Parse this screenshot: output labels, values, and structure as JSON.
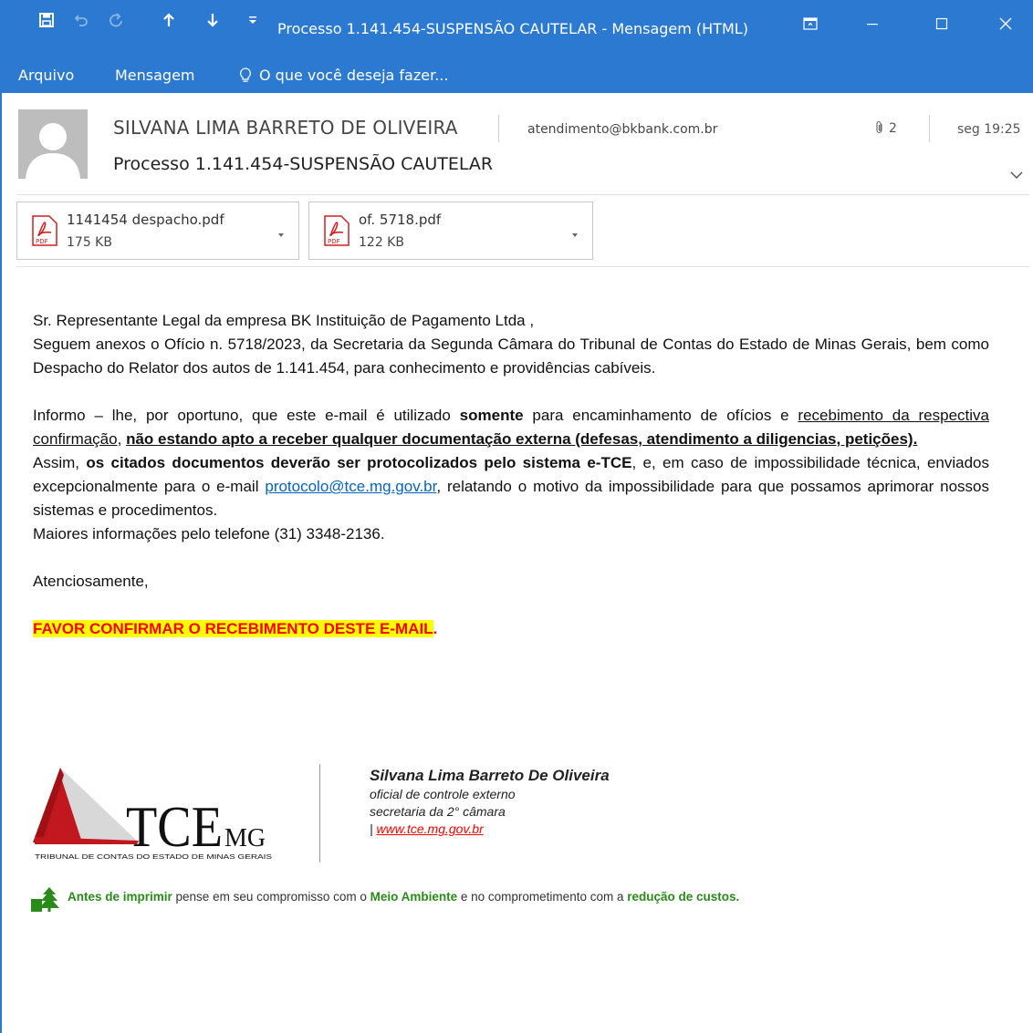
{
  "window": {
    "title": "Processo 1.141.454-SUSPENSÃO CAUTELAR - Mensagem (HTML)",
    "brand_color": "#2b79d0"
  },
  "ribbon": {
    "tabs": [
      "Arquivo",
      "Mensagem"
    ],
    "tell_me": "O que você deseja fazer..."
  },
  "message": {
    "sender": "SILVANA LIMA BARRETO DE OLIVEIRA",
    "recipient": "atendimento@bkbank.com.br",
    "attachment_count": "2",
    "date": "seg 19:25",
    "subject": "Processo 1.141.454-SUSPENSÃO CAUTELAR"
  },
  "attachments": [
    {
      "name": "1141454 despacho.pdf",
      "size": "175 KB",
      "icon": "pdf-icon"
    },
    {
      "name": "of. 5718.pdf",
      "size": "122 KB",
      "icon": "pdf-icon"
    }
  ],
  "body": {
    "greeting": "Sr. Representante Legal da empresa BK Instituição de Pagamento Ltda ,",
    "para1": "Seguem anexos o Ofício n. 5718/2023, da Secretaria da Segunda Câmara do Tribunal de Contas do Estado de Minas Gerais, bem como Despacho do Relator dos autos de 1.141.454, para conhecimento e providências cabíveis.",
    "p2_a": "Informo – lhe, por oportuno, que este e-mail é utilizado ",
    "p2_b": "somente",
    "p2_c": " para encaminhamento de ofícios e ",
    "p2_d": "recebimento da respectiva confirmação",
    "p2_e": ", ",
    "p2_f": "não estando apto a receber qualquer documentação externa (defesas, atendimento a diligencias, petições).",
    "p3_a": "Assim, ",
    "p3_b": "os citados documentos deverão ser protocolizados pelo sistema e-TCE",
    "p3_c": ", e, em caso de impossibilidade técnica, enviados excepcionalmente para o e-mail ",
    "p3_link": "protocolo@tce.mg.gov.br",
    "p3_d": ", relatando o motivo da impossibilidade para que possamos aprimorar nossos sistemas e procedimentos.",
    "phone_line": "Maiores informações pelo telefone (31) 3348-2136.",
    "closing": "Atenciosamente,",
    "confirm": "FAVOR CONFIRMAR O RECEBIMENTO DESTE E-MAIL",
    "confirm_dot": ".",
    "highlight_color": "#ffff00",
    "alert_color": "#ff0000"
  },
  "signature": {
    "logo_text": "TCE",
    "logo_sub": "MG",
    "logo_caption": "TRIBUNAL DE CONTAS DO ESTADO DE MINAS GERAIS",
    "name": "Silvana Lima Barreto De Oliveira",
    "role": "oficial de controle externo",
    "dept": "secretaria da 2° câmara",
    "link_prefix": "| ",
    "link": "www.tce.mg.gov.br"
  },
  "footer": {
    "e1": "Antes de imprimir",
    "e2": " pense em seu compromisso com o ",
    "e3": "Meio Ambiente",
    "e4": " e no comprometimento com a ",
    "e5": "redução de custos.",
    "accent": "#2a8a1a"
  }
}
